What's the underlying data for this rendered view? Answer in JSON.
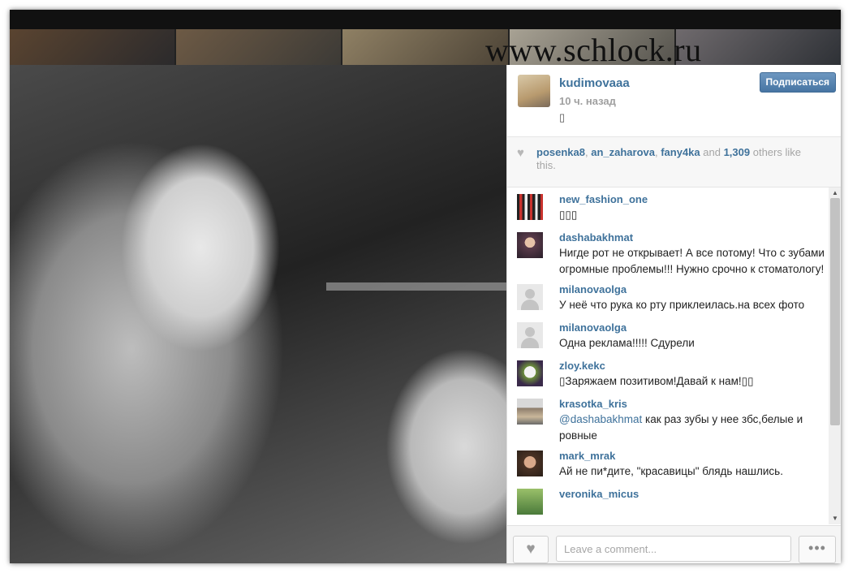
{
  "watermark": "www.schlock.ru",
  "owner": {
    "username": "kudimovaaa",
    "time_ago": "10 ч. назад",
    "caption": "▯",
    "follow_label": "Подписаться"
  },
  "likes": {
    "users": [
      "posenka8",
      "an_zaharova",
      "fany4ka"
    ],
    "sep1": ", ",
    "sep2": ", ",
    "and_text": " and ",
    "count": "1,309",
    "suffix": " others like this."
  },
  "comments": [
    {
      "username": "new_fashion_one",
      "text": "▯▯▯"
    },
    {
      "username": "dashabakhmat",
      "text": "Нигде рот не открывает! А все потому! Что с зубами огромные проблемы!!! Нужно срочно к стоматологу!"
    },
    {
      "username": "milanovaolga",
      "text": "У неё что рука ко рту приклеилась.на всех фото"
    },
    {
      "username": "milanovaolga",
      "text": "Одна реклама!!!!! Сдурели"
    },
    {
      "username": "zloy.kekc",
      "text": "▯Заряжаем позитивом!Давай к нам!▯▯"
    },
    {
      "username": "krasotka_kris",
      "mention": "@dashabakhmat",
      "text": " как раз зубы у нее збс,белые и ровные"
    },
    {
      "username": "mark_mrak",
      "text": "Ай не пи*дите, \"красавицы\" блядь нашлись."
    },
    {
      "username": "veronika_micus",
      "text": ""
    }
  ],
  "comment_input": {
    "placeholder": "Leave a comment..."
  },
  "icons": {
    "like": "heart-icon",
    "more": "ellipsis-icon",
    "scroll_up": "triangle-up-icon",
    "scroll_down": "triangle-down-icon"
  },
  "colors": {
    "link": "#3f729b",
    "follow_button": "#4775a3"
  }
}
